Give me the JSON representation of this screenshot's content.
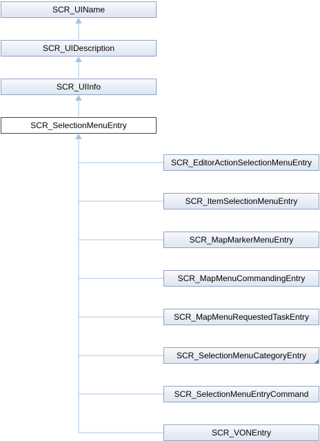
{
  "ancestors": {
    "ui_name": "SCR_UIName",
    "ui_description": "SCR_UIDescription",
    "ui_info": "SCR_UIInfo"
  },
  "current": "SCR_SelectionMenuEntry",
  "children": [
    "SCR_EditorActionSelectionMenuEntry",
    "SCR_ItemSelectionMenuEntry",
    "SCR_MapMarkerMenuEntry",
    "SCR_MapMenuCommandingEntry",
    "SCR_MapMenuRequestedTaskEntry",
    "SCR_SelectionMenuCategoryEntry",
    "SCR_SelectionMenuEntryCommand",
    "SCR_VONEntry"
  ],
  "colors": {
    "edge": "#a7c3e0",
    "node_border": "#8ea2c3",
    "current_border": "#444444"
  }
}
